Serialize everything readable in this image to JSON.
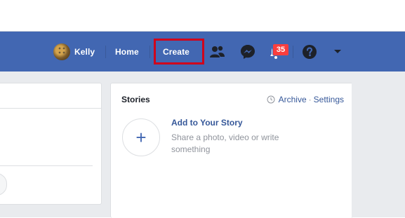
{
  "navbar": {
    "profile_name": "Kelly",
    "home_label": "Home",
    "create_label": "Create",
    "notifications_count": "35",
    "icons": [
      "friend-requests-icon",
      "messenger-icon",
      "notifications-icon",
      "help-icon",
      "account-menu-chevron-icon"
    ],
    "colors": {
      "bar": "#4267b2",
      "highlight_box": "#d0021b",
      "badge": "#fa3e3e"
    }
  },
  "stories": {
    "title": "Stories",
    "archive_label": "Archive",
    "separator": "·",
    "settings_label": "Settings",
    "add_title": "Add to Your Story",
    "add_subtitle": "Share a photo, video or write something",
    "add_glyph": "+"
  }
}
